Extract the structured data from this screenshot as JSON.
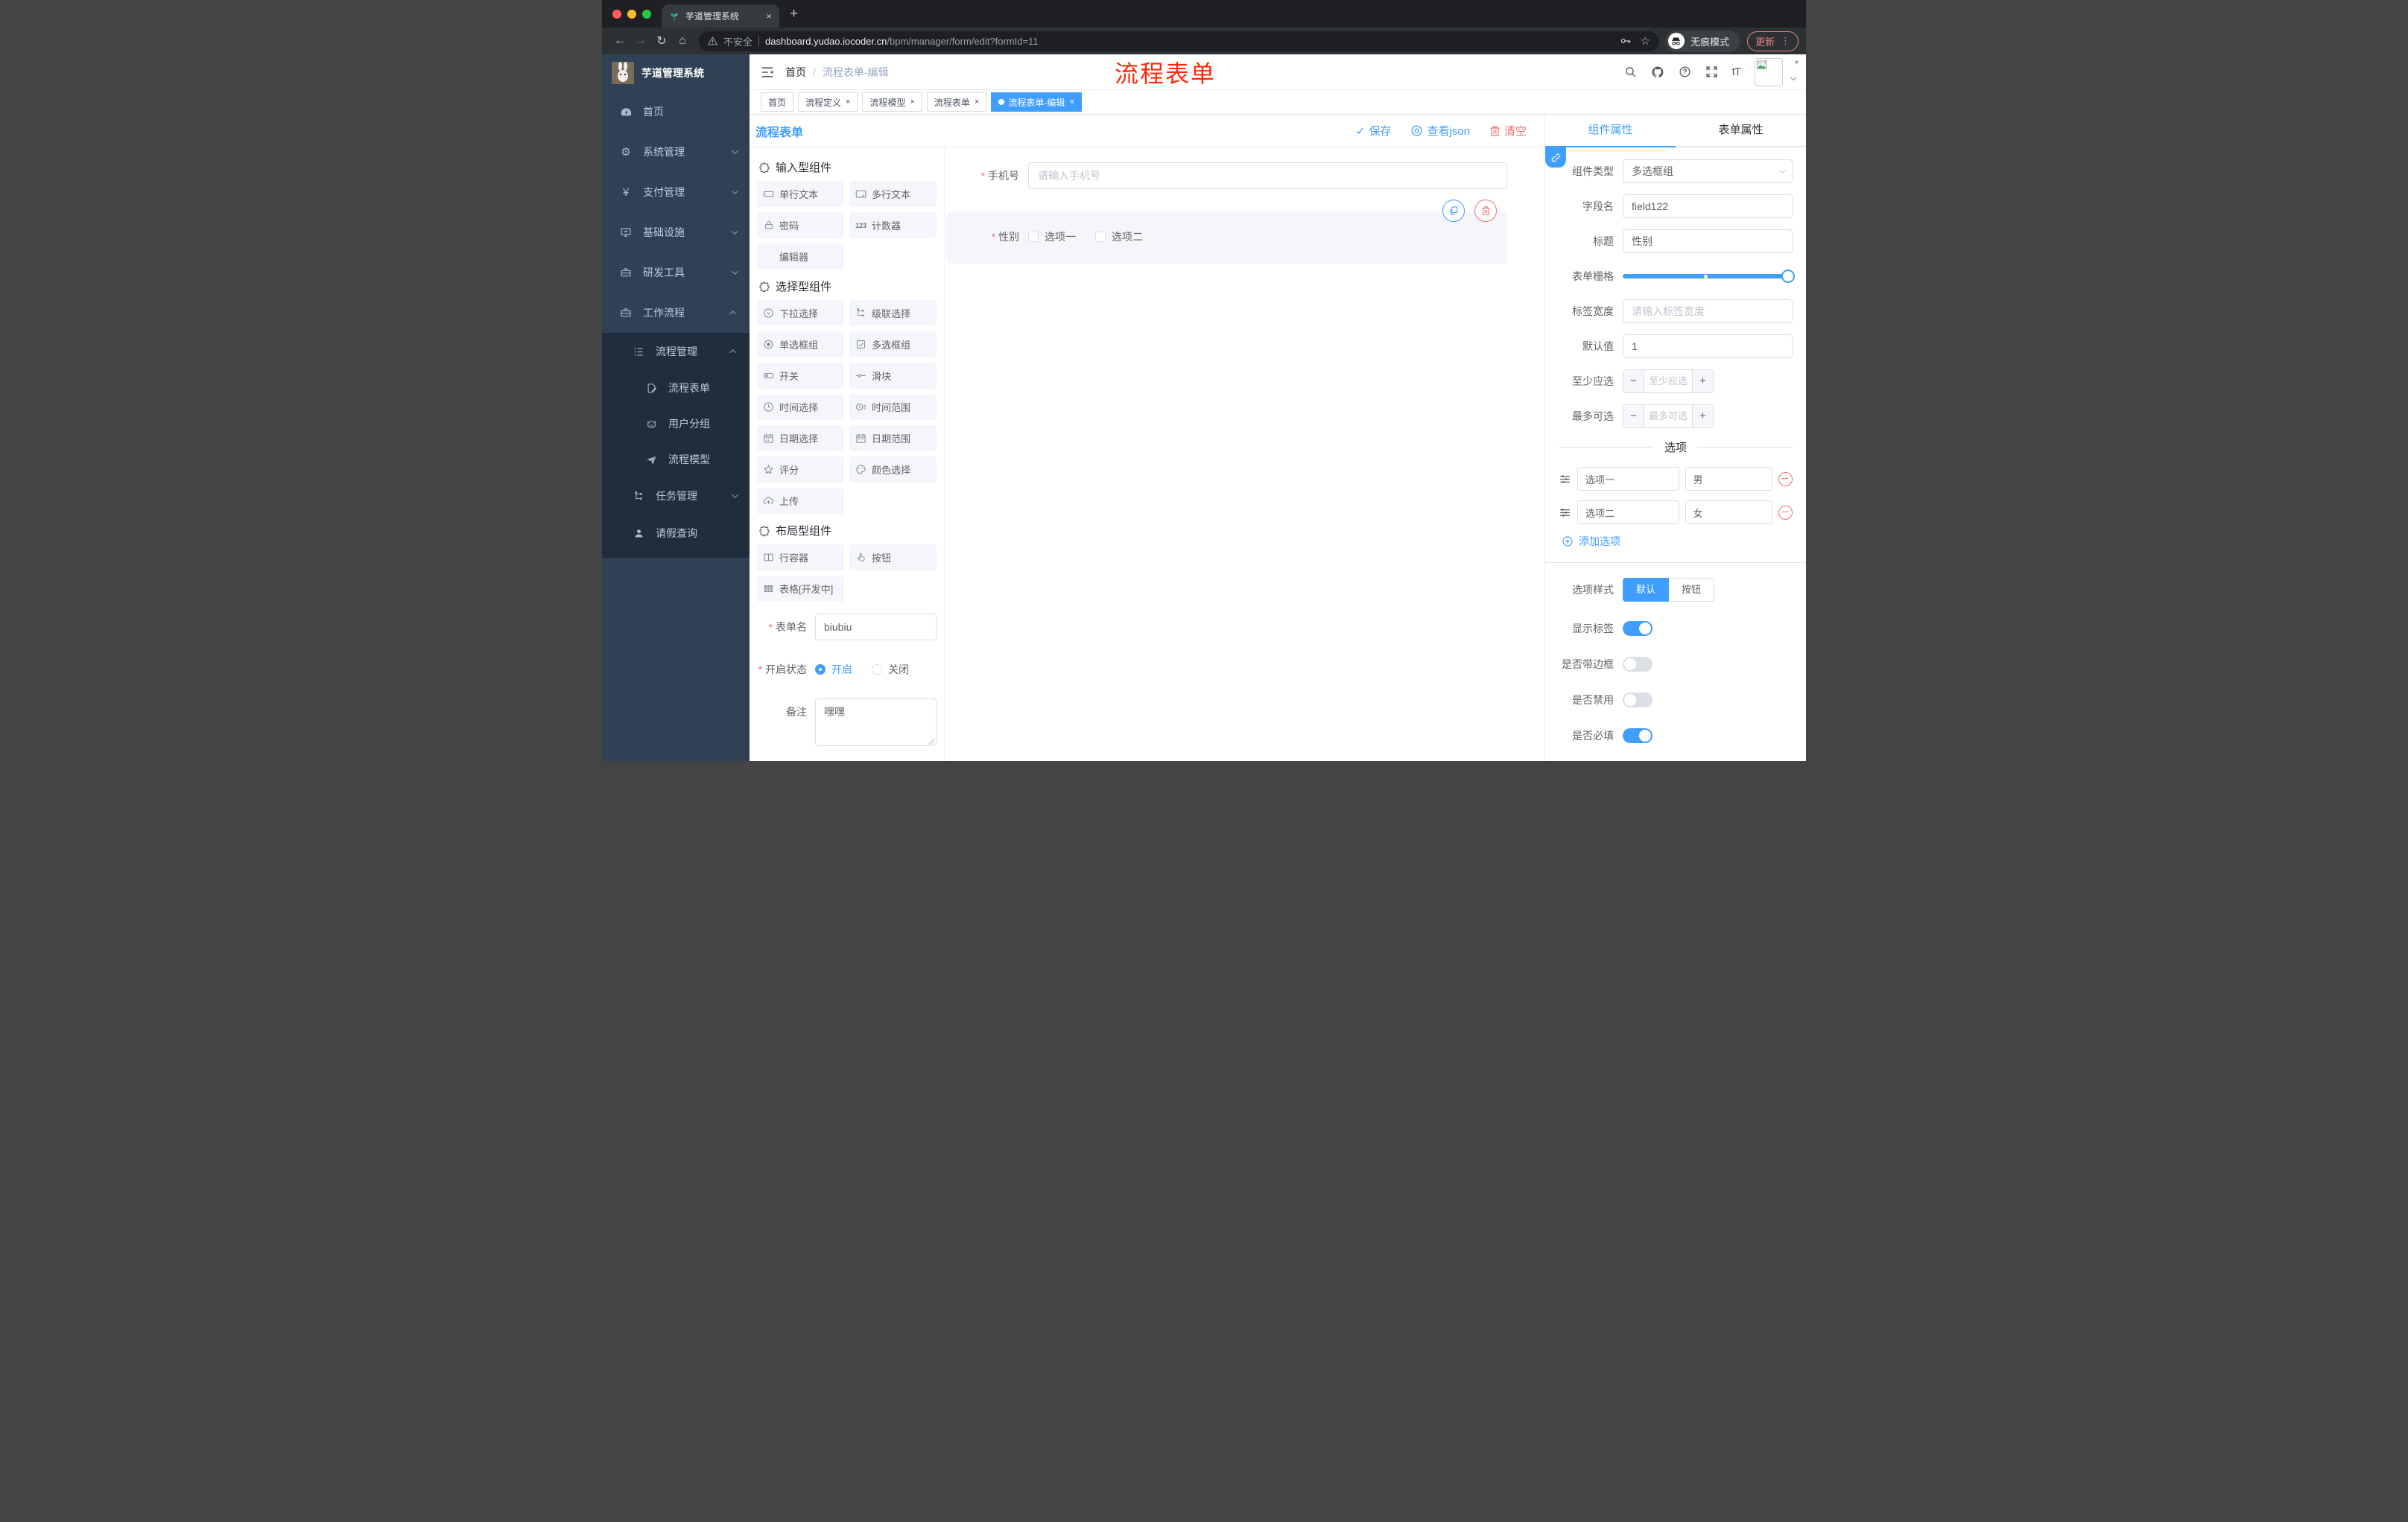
{
  "colors": {
    "accent": "#409eff",
    "danger": "#f56c6c",
    "annotation_red": "#fb2b08",
    "sidebar_bg": "#304156",
    "submenu_bg": "#1f2d3d"
  },
  "icons": {
    "close": "×",
    "plus": "+",
    "back": "←",
    "forward": "→",
    "reload": "↻",
    "home": "⌂",
    "star": "☆",
    "dots": "⋮",
    "caret": "▾",
    "check": "✓",
    "gear": "⚙",
    "yen": "¥",
    "font_size": "tT",
    "counter": "123",
    "question": "?"
  },
  "browser": {
    "tab_title": "芋道管理系统",
    "security_label": "不安全",
    "url_host": "dashboard.yudao.iocoder.cn",
    "url_path": "/bpm/manager/form/edit?formId=11",
    "incognito_label": "无痕模式",
    "update_label": "更新"
  },
  "annotation": {
    "text": "流程表单"
  },
  "sidebar": {
    "logo_title": "芋道管理系统",
    "menu": [
      {
        "label": "首页"
      },
      {
        "label": "系统管理"
      },
      {
        "label": "支付管理"
      },
      {
        "label": "基础设施"
      },
      {
        "label": "研发工具"
      },
      {
        "label": "工作流程"
      }
    ],
    "submenu": [
      {
        "label": "流程管理"
      },
      {
        "label": "流程表单"
      },
      {
        "label": "用户分组"
      },
      {
        "label": "流程模型"
      },
      {
        "label": "任务管理"
      },
      {
        "label": "请假查询"
      }
    ]
  },
  "navbar": {
    "breadcrumb_home": "首页",
    "breadcrumb_sep": "/",
    "breadcrumb_current": "流程表单-编辑"
  },
  "tags": [
    {
      "label": "首页"
    },
    {
      "label": "流程定义"
    },
    {
      "label": "流程模型"
    },
    {
      "label": "流程表单"
    },
    {
      "label": "流程表单-编辑"
    }
  ],
  "editor": {
    "title": "流程表单",
    "save": "保存",
    "view_json": "查看json",
    "clear": "清空"
  },
  "components": {
    "section_input": "输入型组件",
    "section_select": "选择型组件",
    "section_layout": "布局型组件",
    "input_items": [
      "单行文本",
      "多行文本",
      "密码",
      "计数器",
      "编辑器"
    ],
    "select_items": [
      "下拉选择",
      "级联选择",
      "单选框组",
      "多选框组",
      "开关",
      "滑块",
      "时间选择",
      "时间范围",
      "日期选择",
      "日期范围",
      "评分",
      "颜色选择",
      "上传"
    ],
    "layout_items": [
      "行容器",
      "按钮",
      "表格[开发中]"
    ]
  },
  "meta": {
    "form_name_label": "表单名",
    "form_name_value": "biubiu",
    "status_label": "开启状态",
    "status_on": "开启",
    "status_off": "关闭",
    "remark_label": "备注",
    "remark_value": "嘿嘿"
  },
  "canvas": {
    "phone_label": "手机号",
    "phone_placeholder": "请输入手机号",
    "gender_label": "性别",
    "gender_opt1": "选项一",
    "gender_opt2": "选项二"
  },
  "props": {
    "tab_component": "组件属性",
    "tab_form": "表单属性",
    "type_label": "组件类型",
    "type_value": "多选框组",
    "field_label": "字段名",
    "field_value": "field122",
    "title_label": "标题",
    "title_value": "性别",
    "grid_label": "表单栅格",
    "width_label": "标签宽度",
    "width_placeholder": "请输入标签宽度",
    "default_label": "默认值",
    "default_value": "1",
    "min_label": "至少应选",
    "min_placeholder": "至少应选",
    "max_label": "最多可选",
    "max_placeholder": "最多可选",
    "options_title": "选项",
    "options": [
      {
        "name": "选项一",
        "value": "男"
      },
      {
        "name": "选项二",
        "value": "女"
      }
    ],
    "add_option": "添加选项",
    "style_label": "选项样式",
    "style_default": "默认",
    "style_button": "按钮",
    "show_label_label": "显示标签",
    "border_label": "是否带边框",
    "disabled_label": "是否禁用",
    "required_label": "是否必填"
  }
}
